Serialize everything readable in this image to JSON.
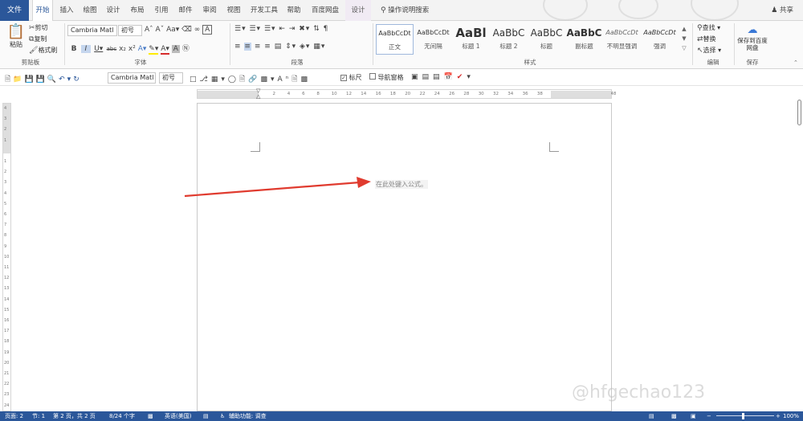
{
  "tabs": {
    "file": "文件",
    "items": [
      "开始",
      "插入",
      "绘图",
      "设计",
      "布局",
      "引用",
      "邮件",
      "审阅",
      "视图",
      "开发工具",
      "帮助",
      "百度网盘"
    ],
    "design": "设计",
    "search_help": "操作说明搜索",
    "share": "共享"
  },
  "clipboard": {
    "paste": "粘贴",
    "cut": "剪切",
    "copy": "复制",
    "format_painter": "格式刷",
    "label": "剪贴板"
  },
  "font": {
    "name": "Cambria Matl",
    "size": "初号",
    "label": "字体"
  },
  "paragraph": {
    "label": "段落"
  },
  "styles": {
    "items": [
      {
        "sample": "AaBbCcDt",
        "name": "正文"
      },
      {
        "sample": "AaBbCcDt",
        "name": "无间隔"
      },
      {
        "sample": "AaBl",
        "name": "标题 1"
      },
      {
        "sample": "AaBbC",
        "name": "标题 2"
      },
      {
        "sample": "AaBbC",
        "name": "标题"
      },
      {
        "sample": "AaBbC",
        "name": "副标题"
      },
      {
        "sample": "AaBbCcDt",
        "name": "不明显强调"
      },
      {
        "sample": "AaBbCcDt",
        "name": "强调"
      }
    ],
    "label": "样式"
  },
  "editing": {
    "find": "查找",
    "replace": "替换",
    "select": "选择",
    "label": "编辑"
  },
  "save_group": {
    "button": "保存到百度网盘",
    "label": "保存"
  },
  "qat": {
    "font": "Cambria Matl",
    "size": "初号",
    "ruler": "标尺",
    "nav_pane": "导航窗格"
  },
  "ruler": {
    "h_ticks": [
      "8",
      "6",
      "4",
      "2",
      "",
      "2",
      "4",
      "6",
      "8",
      "10",
      "12",
      "14",
      "16",
      "18",
      "20",
      "22",
      "24",
      "26",
      "28",
      "30",
      "32",
      "34",
      "36",
      "38",
      "40",
      "42",
      "44",
      "46",
      "48"
    ],
    "v_ticks": [
      "4",
      "3",
      "2",
      "1",
      "",
      "1",
      "2",
      "3",
      "4",
      "5",
      "6",
      "7",
      "8",
      "9",
      "10",
      "11",
      "12",
      "13",
      "14",
      "15",
      "16",
      "17",
      "18",
      "19",
      "20",
      "21",
      "22",
      "23",
      "24"
    ]
  },
  "document": {
    "placeholder": "在此处键入公式。"
  },
  "watermark": "@hfgechao123",
  "status": {
    "page": "页面: 2",
    "section": "节: 1",
    "pages": "第 2 页，共 2 页",
    "words": "8/24 个字",
    "language": "英语(美国)",
    "accessibility": "辅助功能: 调查",
    "zoom": "100%"
  }
}
